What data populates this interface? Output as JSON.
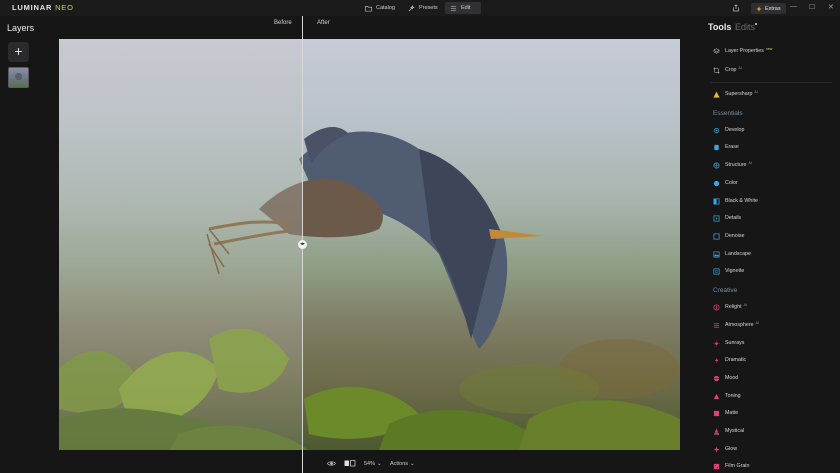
{
  "app": {
    "logo_main": "LUMINAR",
    "logo_accent": "NEO",
    "accent_color": "#c8d84a"
  },
  "nav": {
    "catalog": "Catalog",
    "presets": "Presets",
    "edit": "Edit",
    "extras": "Extras"
  },
  "window_controls": {
    "minimize": "—",
    "maximize": "☐",
    "close": "✕"
  },
  "layers": {
    "title": "Layers",
    "add_symbol": "+"
  },
  "canvas": {
    "before_label": "Before",
    "after_label": "After",
    "handle_symbol": "◂▸"
  },
  "bottom_bar": {
    "zoom": "54%",
    "zoom_chevron": "⌄",
    "actions": "Actions",
    "actions_chevron": "⌄"
  },
  "right_panel": {
    "tabs": {
      "tools": "Tools",
      "edits": "Edits"
    },
    "top_tools": [
      {
        "label": "Layer Properties",
        "badge": "new",
        "icon": "layers-icon"
      },
      {
        "label": "Crop",
        "badge": "AI",
        "icon": "crop-icon"
      },
      {
        "label": "Supersharp",
        "badge": "AI",
        "icon": "supersharp-icon"
      }
    ],
    "sections": [
      {
        "title": "Essentials",
        "items": [
          {
            "label": "Develop",
            "icon": "develop-icon",
            "color": "#3aa7e8"
          },
          {
            "label": "Erase",
            "icon": "erase-icon",
            "color": "#3aa7e8"
          },
          {
            "label": "Structure",
            "badge": "AI",
            "icon": "structure-icon",
            "color": "#3aa7e8"
          },
          {
            "label": "Color",
            "icon": "color-icon",
            "color": "#3aa7e8"
          },
          {
            "label": "Black & White",
            "icon": "bw-icon",
            "color": "#3aa7e8"
          },
          {
            "label": "Details",
            "icon": "details-icon",
            "color": "#3aa7e8"
          },
          {
            "label": "Denoise",
            "icon": "denoise-icon",
            "color": "#3aa7e8"
          },
          {
            "label": "Landscape",
            "icon": "landscape-icon",
            "color": "#3aa7e8"
          },
          {
            "label": "Vignette",
            "icon": "vignette-icon",
            "color": "#3aa7e8"
          }
        ]
      },
      {
        "title": "Creative",
        "items": [
          {
            "label": "Relight",
            "badge": "AI",
            "icon": "relight-icon",
            "color": "#e0407a"
          },
          {
            "label": "Atmosphere",
            "badge": "AI",
            "icon": "atmosphere-icon",
            "color": "#e0407a"
          },
          {
            "label": "Sunrays",
            "icon": "sunrays-icon",
            "color": "#e0407a"
          },
          {
            "label": "Dramatic",
            "icon": "dramatic-icon",
            "color": "#e0407a"
          },
          {
            "label": "Mood",
            "icon": "mood-icon",
            "color": "#e0407a"
          },
          {
            "label": "Toning",
            "icon": "toning-icon",
            "color": "#e0407a"
          },
          {
            "label": "Matte",
            "icon": "matte-icon",
            "color": "#e0407a"
          },
          {
            "label": "Mystical",
            "icon": "mystical-icon",
            "color": "#e0407a"
          },
          {
            "label": "Glow",
            "icon": "glow-icon",
            "color": "#e0407a"
          },
          {
            "label": "Film Grain",
            "icon": "film-grain-icon",
            "color": "#e0407a"
          }
        ]
      }
    ]
  }
}
